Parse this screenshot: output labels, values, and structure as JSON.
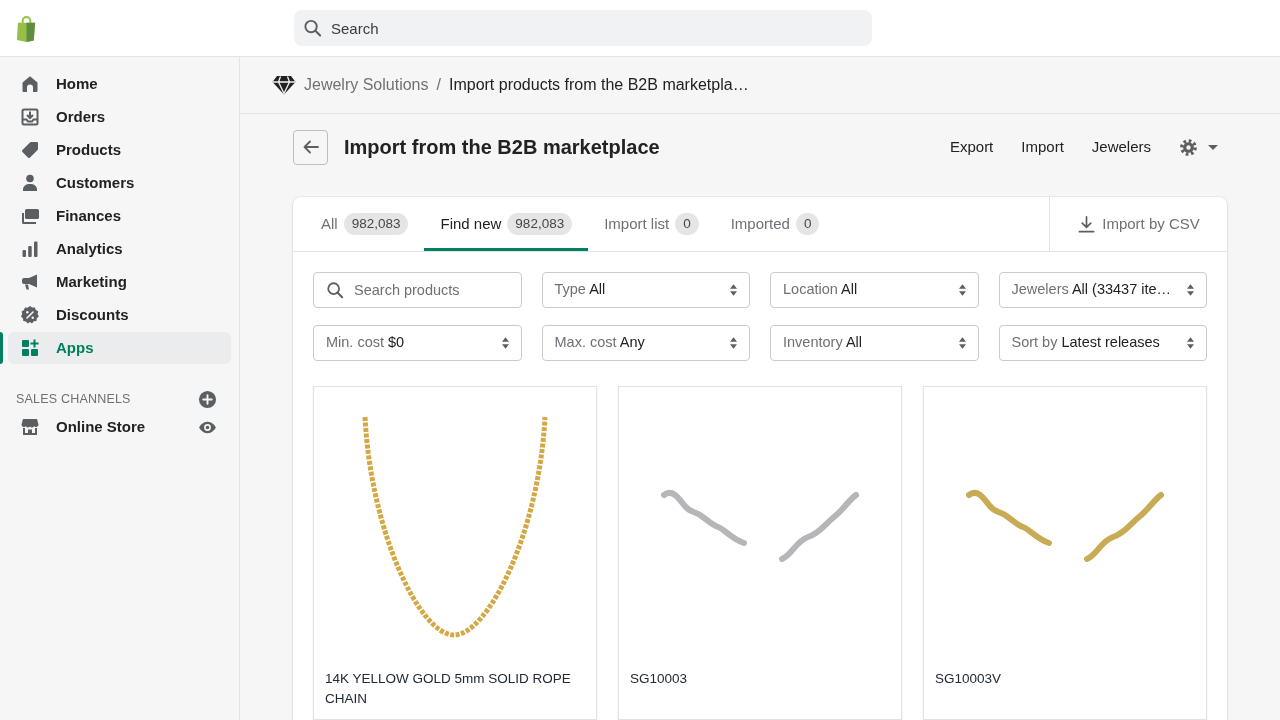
{
  "top_bar": {
    "search": {
      "placeholder": "Search"
    }
  },
  "sidebar": {
    "items": [
      {
        "label": "Home",
        "selected": false
      },
      {
        "label": "Orders",
        "selected": false
      },
      {
        "label": "Products",
        "selected": false
      },
      {
        "label": "Customers",
        "selected": false
      },
      {
        "label": "Finances",
        "selected": false
      },
      {
        "label": "Analytics",
        "selected": false
      },
      {
        "label": "Marketing",
        "selected": false
      },
      {
        "label": "Discounts",
        "selected": false
      },
      {
        "label": "Apps",
        "selected": true
      }
    ],
    "sales_channels": {
      "heading": "SALES CHANNELS",
      "items": [
        {
          "label": "Online Store"
        }
      ]
    }
  },
  "breadcrumb": {
    "parent": "Jewelry Solutions",
    "separator": "/",
    "current": "Import products from the B2B marketpla…"
  },
  "page_header": {
    "title": "Import from the B2B marketplace",
    "actions": [
      "Export",
      "Import",
      "Jewelers"
    ]
  },
  "tabs": [
    {
      "label": "All",
      "count": "982,083",
      "selected": false
    },
    {
      "label": "Find new",
      "count": "982,083",
      "selected": true
    },
    {
      "label": "Import list",
      "count": "0",
      "selected": false
    },
    {
      "label": "Imported",
      "count": "0",
      "selected": false
    }
  ],
  "csv_button": {
    "label": "Import by CSV"
  },
  "product_search": {
    "placeholder": "Search products"
  },
  "filters": [
    {
      "label": "Type",
      "value": "All"
    },
    {
      "label": "Location",
      "value": "All"
    },
    {
      "label": "Jewelers",
      "value": "All (33437 ite…"
    },
    {
      "label": "Min. cost",
      "value": "$0"
    },
    {
      "label": "Max. cost",
      "value": "Any"
    },
    {
      "label": "Inventory",
      "value": "All"
    },
    {
      "label": "Sort by",
      "value": "Latest releases"
    }
  ],
  "products": [
    {
      "title": "14K YELLOW GOLD 5mm SOLID ROPE CHAIN",
      "kind": "necklace",
      "color": "#d3a845"
    },
    {
      "title": "SG10003",
      "kind": "earrings",
      "color": "#b4b6b9"
    },
    {
      "title": "SG10003V",
      "kind": "earrings",
      "color": "#c9ab55"
    }
  ]
}
